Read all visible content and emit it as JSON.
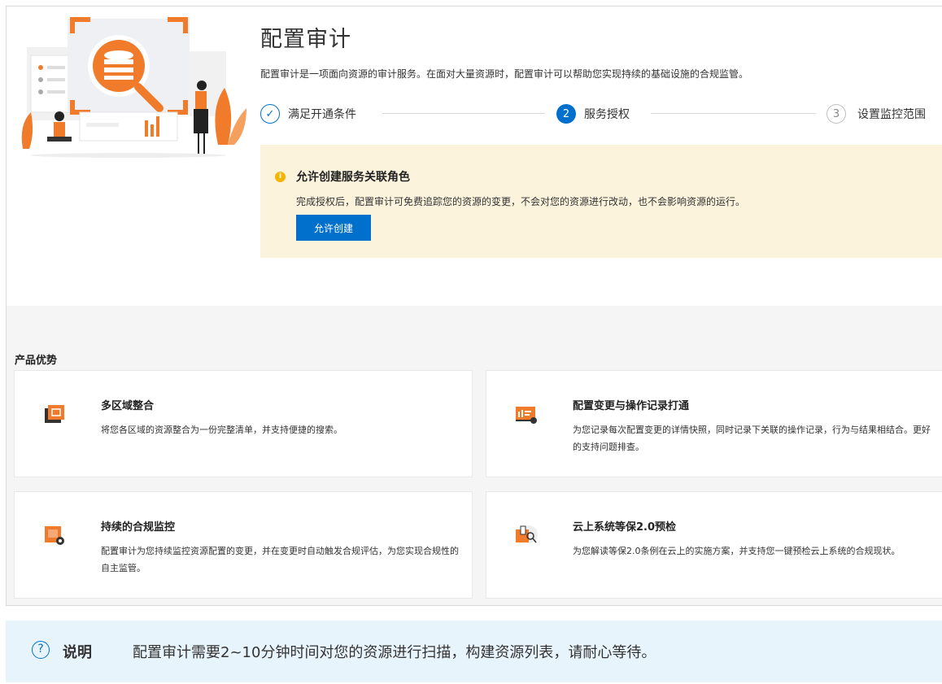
{
  "header": {
    "title": "配置审计",
    "description": "配置审计是一项面向资源的审计服务。在面对大量资源时，配置审计可以帮助您实现持续的基础设施的合规监管。"
  },
  "steps": [
    {
      "number": "✓",
      "label": "满足开通条件",
      "state": "done"
    },
    {
      "number": "2",
      "label": "服务授权",
      "state": "active"
    },
    {
      "number": "3",
      "label": "设置监控范围",
      "state": "todo"
    }
  ],
  "notice": {
    "icon": "i",
    "title": "允许创建服务关联角色",
    "body": "完成授权后，配置审计可免费追踪您的资源的变更，不会对您的资源进行改动，也不会影响资源的运行。",
    "button_label": "允许创建"
  },
  "advantages": {
    "title": "产品优势",
    "cards": [
      {
        "icon": "multi-region-icon",
        "title": "多区域整合",
        "desc": "将您各区域的资源整合为一份完整清单，并支持便捷的搜索。"
      },
      {
        "icon": "config-change-icon",
        "title": "配置变更与操作记录打通",
        "desc": "为您记录每次配置变更的详情快照，同时记录下关联的操作记录，行为与结果相结合。更好的支持问题排查。"
      },
      {
        "icon": "compliance-monitor-icon",
        "title": "持续的合规监控",
        "desc": "配置审计为您持续监控资源配置的变更，并在变更时自动触发合规评估，为您实现合规性的自主监管。"
      },
      {
        "icon": "cloud-check-icon",
        "title": "云上系统等保2.0预检",
        "desc": "为您解读等保2.0条例在云上的实施方案，并支持您一键预检云上系统的合规现状。"
      }
    ]
  },
  "note": {
    "icon": "?",
    "label": "说明",
    "text": "配置审计需要2~10分钟时间对您的资源进行扫描，构建资源列表，请耐心等待。"
  },
  "colors": {
    "primary": "#0070cc",
    "accent": "#f07b2b",
    "notice_bg": "#fcf3dd",
    "note_bg": "#e8f4fc"
  }
}
